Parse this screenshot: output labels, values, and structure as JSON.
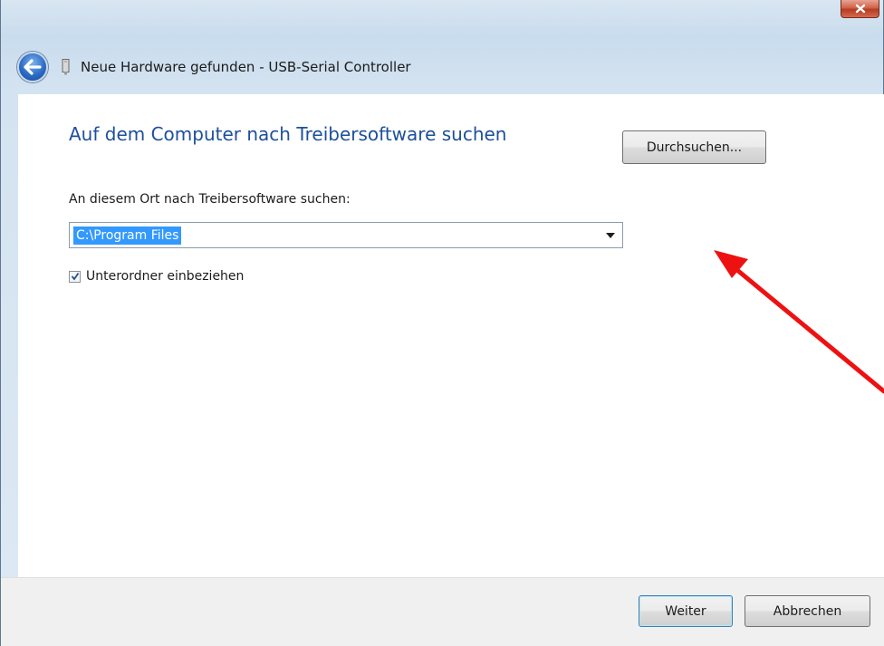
{
  "window": {
    "title": "Neue Hardware gefunden - USB-Serial Controller",
    "icons": {
      "back": "back-arrow-icon",
      "device": "usb-device-icon",
      "close": "close-icon"
    }
  },
  "page": {
    "heading": "Auf dem Computer nach Treibersoftware suchen",
    "location_label": "An diesem Ort nach Treibersoftware suchen:",
    "location_value": "C:\\Program Files",
    "browse_button": "Durchsuchen...",
    "subfolders_checkbox": {
      "label": "Unterordner einbeziehen",
      "checked": true
    }
  },
  "footer": {
    "next_button": "Weiter",
    "cancel_button": "Abbrechen"
  },
  "annotation": {
    "color": "#ee1111",
    "icon": "red-arrow-pointer"
  },
  "colors": {
    "accent_heading": "#1d4f9a",
    "selection": "#3399ff",
    "close_button": "#c9503a"
  }
}
